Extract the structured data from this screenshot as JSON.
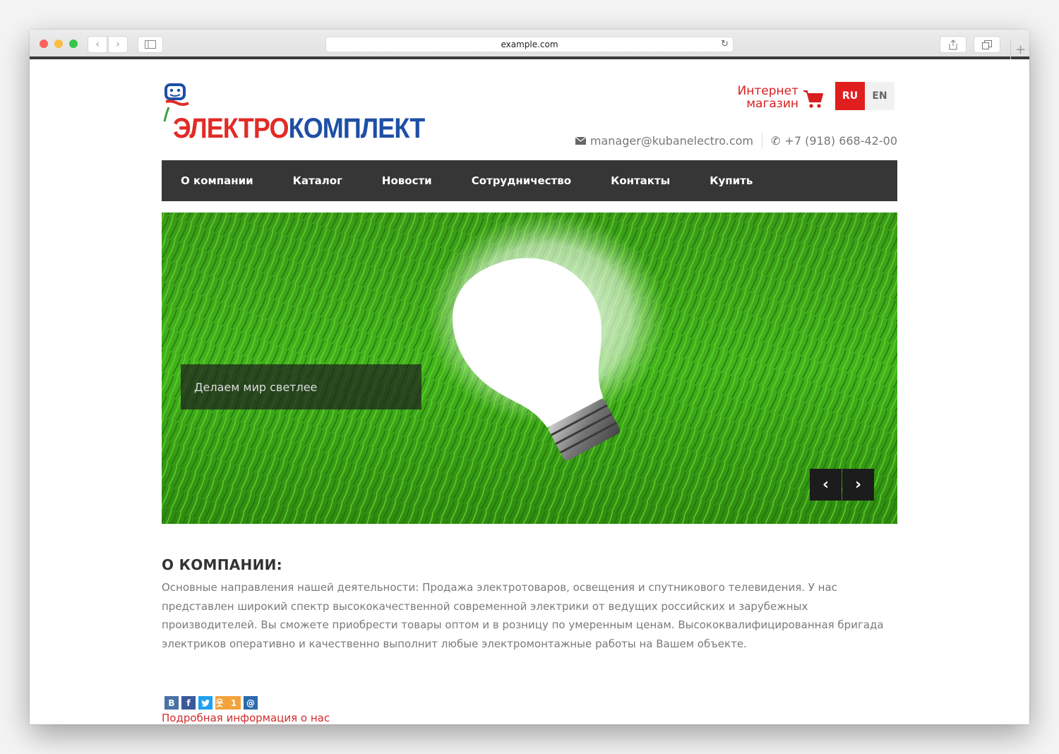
{
  "browser": {
    "url": "example.com"
  },
  "logo": {
    "part1": "ЭЛЕКТРО",
    "part2": "КОМПЛЕКТ"
  },
  "header": {
    "shop_line1": "Интернет",
    "shop_line2": "магазин",
    "lang_ru": "RU",
    "lang_en": "EN",
    "email": "manager@kubanelectro.com",
    "phone": "+7 (918) 668-42-00"
  },
  "menu": {
    "items": [
      {
        "label": "О компании"
      },
      {
        "label": "Каталог"
      },
      {
        "label": "Новости"
      },
      {
        "label": "Сотрудничество"
      },
      {
        "label": "Контакты"
      },
      {
        "label": "Купить"
      }
    ]
  },
  "hero": {
    "caption": "Делаем мир светлее"
  },
  "about": {
    "title": "О КОМПАНИИ:",
    "text": "Основные направления нашей деятельности: Продажа электротоваров, освещения и спутникового телевидения. У нас представлен широкий спектр высококачественной современной электрики от ведущих российских и зарубежных производителей. Вы сможете приобрести товары оптом и в розницу по умеренным ценам. Высококвалифицированная бригада электриков оперативно и качественно выполнит любые электромонтажные работы на Вашем объекте.",
    "more_link": "Подробная информация о нас"
  },
  "social": {
    "vk": "В",
    "fb": "f",
    "ok_count": "1",
    "mr": "@"
  },
  "colors": {
    "brand_red": "#e22b26",
    "brand_blue": "#1e4fa6",
    "menu_bg": "#363636",
    "link_red": "#d22b2b"
  }
}
